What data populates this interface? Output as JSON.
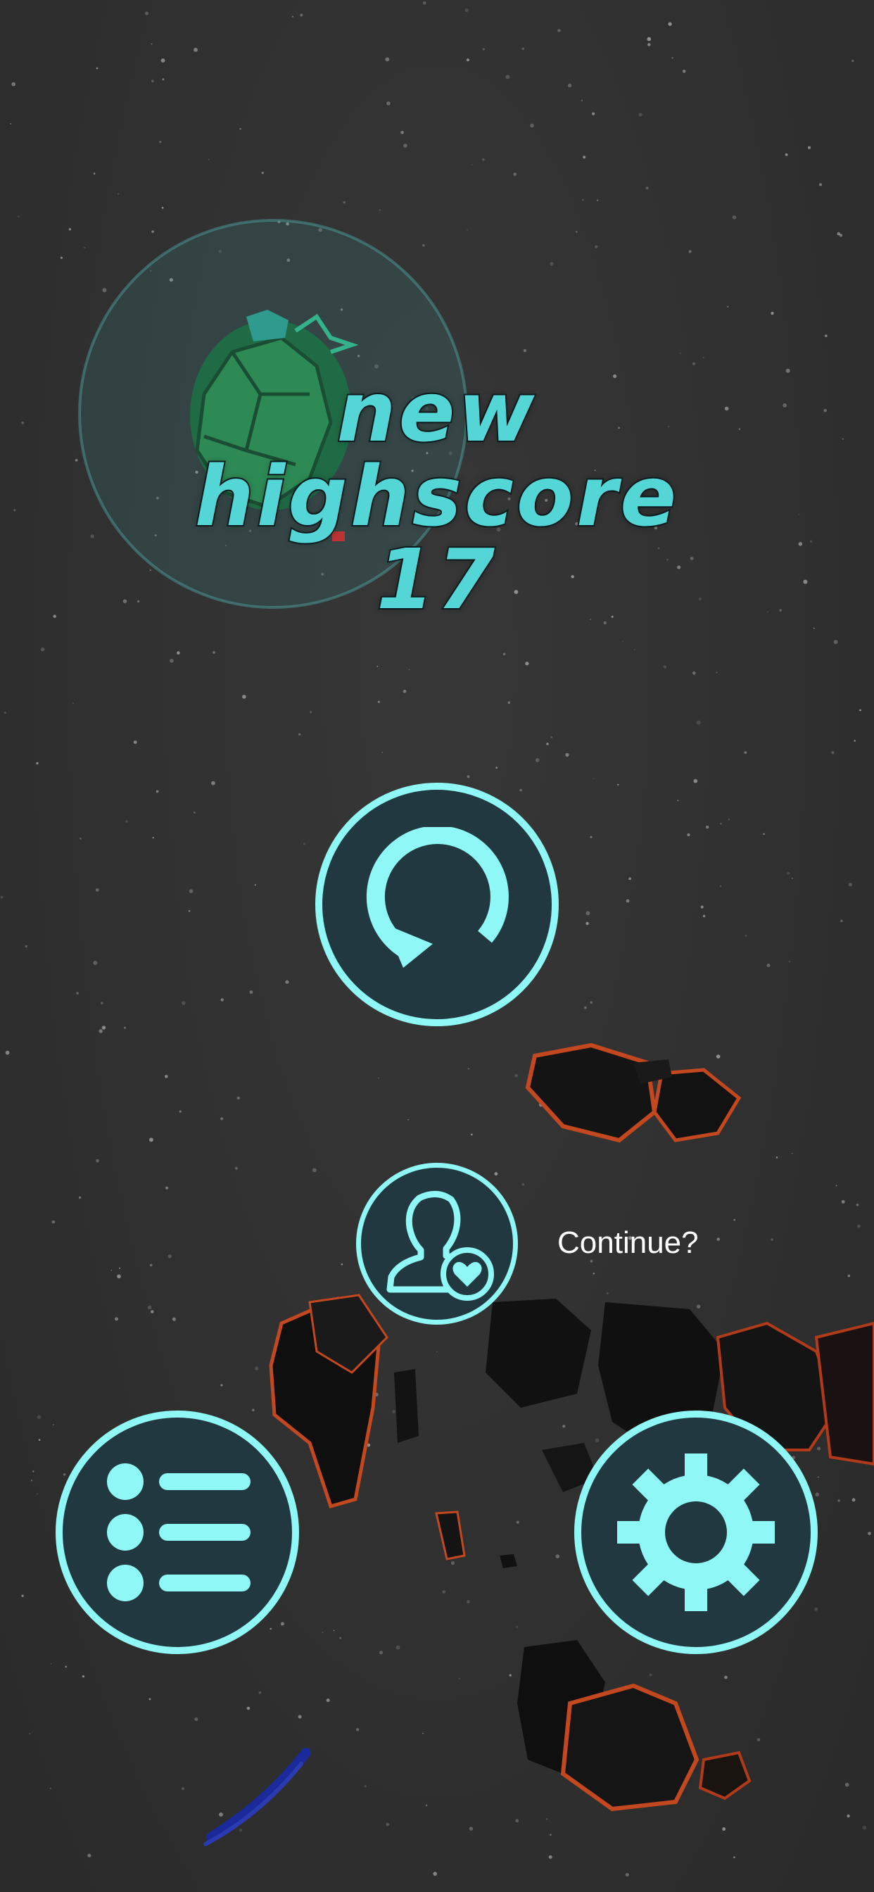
{
  "highscore": {
    "line1": "New",
    "line2": "Highscore",
    "score": "17"
  },
  "buttons": {
    "restart_icon": "restart-icon",
    "continue_icon": "revive-player-heart-icon",
    "continue_label": "Continue?",
    "menu_icon": "list-menu-icon",
    "settings_icon": "gear-icon"
  },
  "colors": {
    "accent": "#8ff7f5",
    "button_fill": "#213840",
    "title": "#55d6d6",
    "background": "#2f2f2f"
  }
}
